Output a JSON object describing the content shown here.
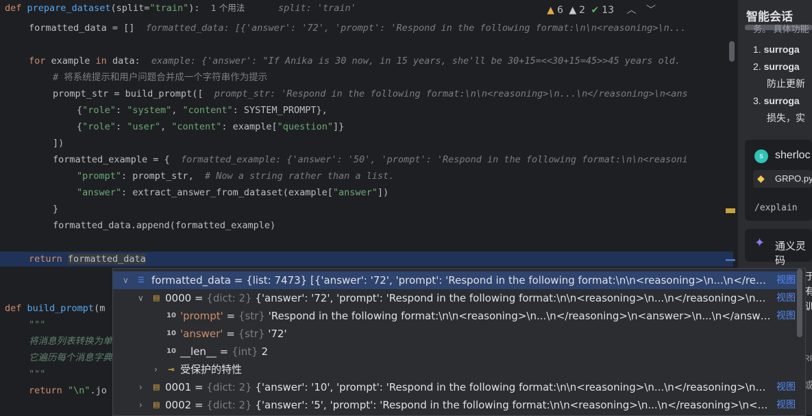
{
  "editor": {
    "header": {
      "def_kw": "def",
      "fn_name": "prepare_dataset",
      "sig_pre": "(split=",
      "sig_str": "\"train\"",
      "sig_post": "):",
      "usage_hint": "1 个用法",
      "param_hint": "split: 'train'"
    },
    "warnings": {
      "warn_count": "6",
      "weak_count": "2",
      "ok_count": "13"
    },
    "lines": {
      "l1_code": "formatted_data = []",
      "l1_hint": "formatted_data: [{'answer': '72', 'prompt': 'Respond in the following format:\\n\\n<reasoning>\\n...",
      "l2_for": "for",
      "l2_code": " example ",
      "l2_in": "in",
      "l2_code2": " data:",
      "l2_hint": "example: {'answer': \"If Anika is 30 now, in 15 years, she'll be 30+15=<<30+15=45>>45 years old.",
      "l3_comment": "# 将系统提示和用户问题合并成一个字符串作为提示",
      "l4_code": "prompt_str = build_prompt([",
      "l4_hint": "prompt_str: 'Respond in the following format:\\n\\n<reasoning>\\n...\\n</reasoning>\\n<ans",
      "l5_open": "{",
      "l5_k1": "\"role\"",
      "l5_v1": "\"system\"",
      "l5_k2": "\"content\"",
      "l5_v2": ": SYSTEM_PROMPT},",
      "l6_open": "{",
      "l6_k1": "\"role\"",
      "l6_v1": "\"user\"",
      "l6_k2": "\"content\"",
      "l6_v2a": ": example[",
      "l6_v2s": "\"question\"",
      "l6_v2b": "]}",
      "l7_code": "])",
      "l8_code": "formatted_example = {",
      "l8_hint": "formatted_example: {'answer': '50', 'prompt': 'Respond in the following format:\\n\\n<reasoni",
      "l9_key": "\"prompt\"",
      "l9_code": ": prompt_str,  ",
      "l9_comment": "# Now a string rather than a list.",
      "l10_key": "\"answer\"",
      "l10_code": ": extract_answer_from_dataset(example[",
      "l10_str": "\"answer\"",
      "l10_end": "])",
      "l11_code": "}",
      "l12_code": "formatted_data.append(formatted_example)",
      "l13_kw": "return",
      "l13_code": "formatted_data",
      "l14_def": "def",
      "l14_fn": "build_prompt",
      "l14_rest": "(m",
      "l15_doc": "\"\"\"",
      "l16_doc": "将消息列表转换为单",
      "l17_doc": "它遍历每个消息字典",
      "l18_doc": "\"\"\"",
      "l19_kw": "return",
      "l19_str": "\"\\n\"",
      "l19_rest": ".jo"
    }
  },
  "panel": {
    "title": "智能会话",
    "top_cut": "务。 具体功能",
    "items": [
      "surroga",
      "surroga",
      "防止更新",
      "surroga",
      "损失，实"
    ],
    "item_nums": [
      "1.",
      "2.",
      "3."
    ],
    "user_name": "sherloc",
    "file_name": "GRPO.py",
    "command": "/explain",
    "ai_name": "通义灵码",
    "side_texts": [
      "于",
      "有",
      "训",
      "RP",
      "或"
    ]
  },
  "debug": {
    "rows": [
      {
        "name": "formatted_data",
        "eq": " = ",
        "type": "{list: 7473}",
        "value": " [{'answer': '72', 'prompt': 'Respond in the following format:\\n\\n<reasoning>\\n...\\n</reasoni…",
        "view": "视图"
      },
      {
        "name": "0000",
        "eq": " = ",
        "type": "{dict: 2}",
        "value": " {'answer': '72', 'prompt': 'Respond in the following format:\\n\\n<reasoning>\\n...\\n</reasoning>\\n<answ…",
        "view": "视图"
      },
      {
        "name": "'prompt'",
        "eq": " = ",
        "type": "{str}",
        "value": " 'Respond in the following format:\\n\\n<reasoning>\\n...\\n</reasoning>\\n<answer>\\n...\\n</answer>\\…",
        "view": "视图"
      },
      {
        "name": "'answer'",
        "eq": " = ",
        "type": "{str}",
        "value": " '72'",
        "view": ""
      },
      {
        "name": "__len__",
        "eq": " = ",
        "type": "{int}",
        "value": " 2",
        "view": ""
      },
      {
        "name": "受保护的特性",
        "eq": "",
        "type": "",
        "value": "",
        "view": ""
      },
      {
        "name": "0001",
        "eq": " = ",
        "type": "{dict: 2}",
        "value": " {'answer': '10', 'prompt': 'Respond in the following format:\\n\\n<reasoning>\\n...\\n</reasoning>\\n<answ…",
        "view": "视图"
      },
      {
        "name": "0002",
        "eq": " = ",
        "type": "{dict: 2}",
        "value": " {'answer': '5', 'prompt': 'Respond in the following format:\\n\\n<reasoning>\\n...\\n</reasoning>\\n<answe…",
        "view": "视图"
      }
    ]
  },
  "colors": {
    "keyword": "#cf8e6d",
    "function": "#56a8f5",
    "string": "#6aab73",
    "comment": "#7a7e85",
    "link": "#548af7"
  }
}
